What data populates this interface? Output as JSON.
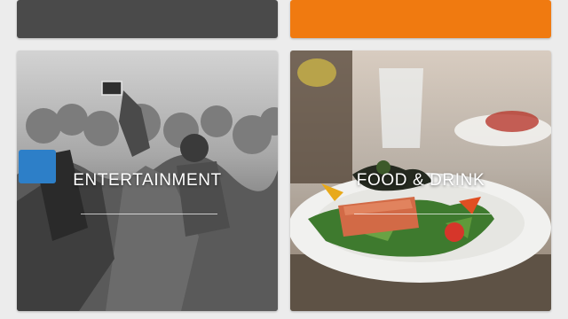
{
  "tiles": [
    {
      "id": "top-dark",
      "label": "",
      "color": "#4a4a4a"
    },
    {
      "id": "top-orange",
      "label": "",
      "color": "#f07a10"
    },
    {
      "id": "entertainment",
      "label": "ENTERTAINMENT",
      "image": "concert-crowd-photo"
    },
    {
      "id": "food-drink",
      "label": "FOOD & DRINK",
      "image": "salmon-salad-plate-photo"
    }
  ],
  "colors": {
    "background": "#ececec",
    "label_text": "#ffffff"
  }
}
